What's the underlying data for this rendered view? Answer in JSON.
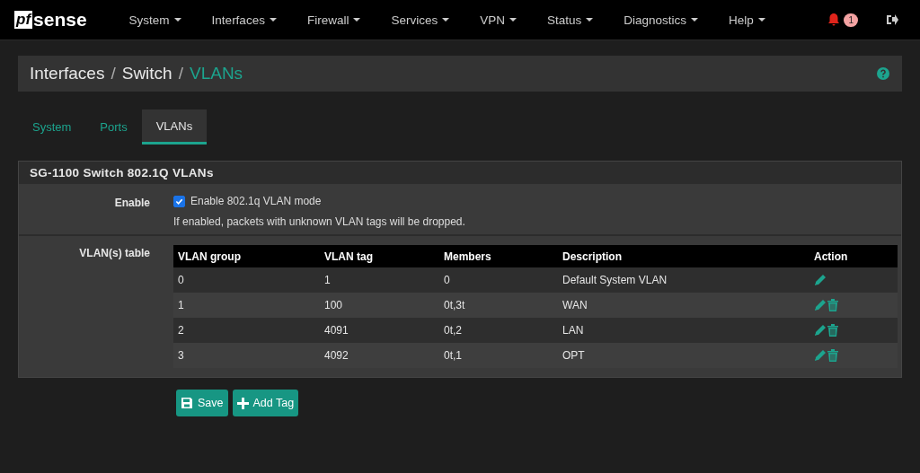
{
  "navbar": {
    "logo": {
      "boxed": "pf",
      "rest": "sense"
    },
    "menus": [
      {
        "label": "System"
      },
      {
        "label": "Interfaces"
      },
      {
        "label": "Firewall"
      },
      {
        "label": "Services"
      },
      {
        "label": "VPN"
      },
      {
        "label": "Status"
      },
      {
        "label": "Diagnostics"
      },
      {
        "label": "Help"
      }
    ],
    "notification_count": "1"
  },
  "breadcrumb": [
    "Interfaces",
    "Switch",
    "VLANs"
  ],
  "breadcrumb_separator": "/",
  "tabs": [
    {
      "label": "System",
      "selected": false
    },
    {
      "label": "Ports",
      "selected": false
    },
    {
      "label": "VLANs",
      "selected": true
    }
  ],
  "panel": {
    "title": "SG-1100 Switch 802.1Q VLANs",
    "enable": {
      "label": "Enable",
      "checked": true,
      "option": "Enable 802.1q VLAN mode",
      "help": "If enabled, packets with unknown VLAN tags will be dropped."
    },
    "table_label": "VLAN(s) table",
    "columns": [
      "VLAN group",
      "VLAN tag",
      "Members",
      "Description",
      "Action"
    ],
    "rows": [
      {
        "group": "0",
        "tag": "1",
        "members": "0",
        "description": "Default System VLAN",
        "deletable": false
      },
      {
        "group": "1",
        "tag": "100",
        "members": "0t,3t",
        "description": "WAN",
        "deletable": true
      },
      {
        "group": "2",
        "tag": "4091",
        "members": "0t,2",
        "description": "LAN",
        "deletable": true
      },
      {
        "group": "3",
        "tag": "4092",
        "members": "0t,1",
        "description": "OPT",
        "deletable": true
      }
    ]
  },
  "buttons": [
    {
      "label": "Save",
      "kind": "save"
    },
    {
      "label": "Add Tag",
      "kind": "add"
    }
  ]
}
